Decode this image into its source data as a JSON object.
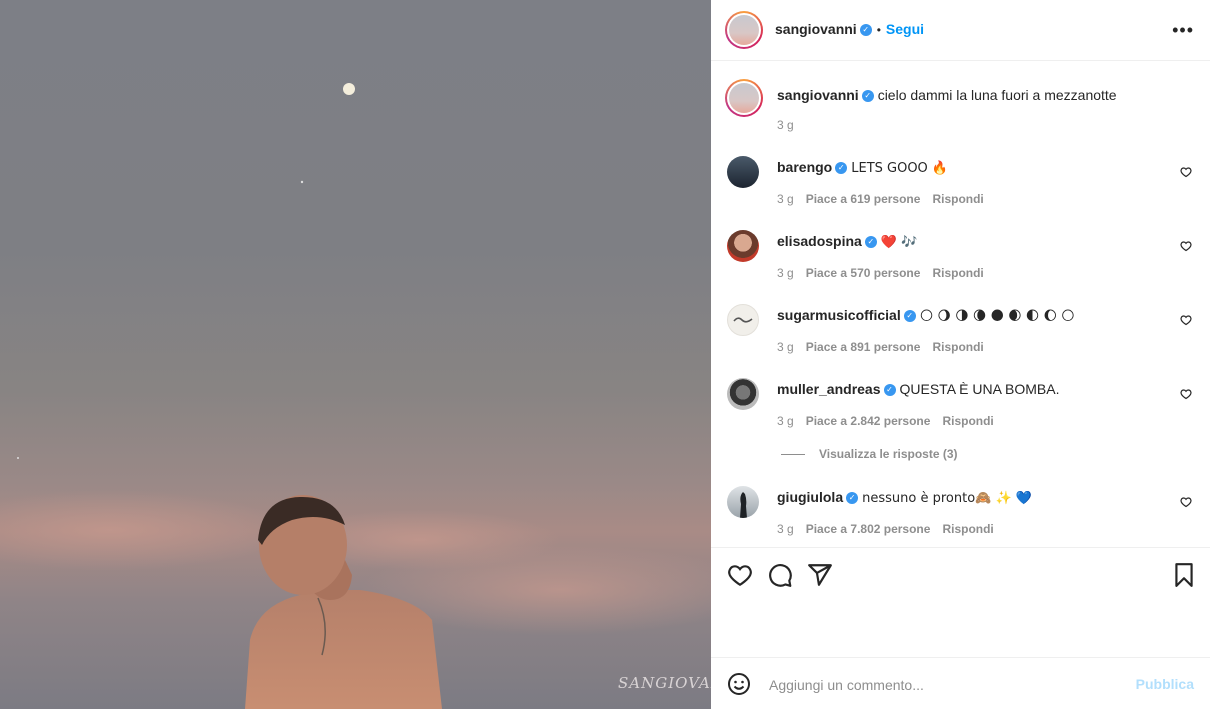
{
  "post": {
    "author": "sangiovanni",
    "follow_label": "Segui",
    "more_icon": "•••",
    "caption": "cielo dammi la luna fuori a mezzanotte",
    "caption_time": "3 g",
    "photo_signature": "SANGIOVANNI"
  },
  "comments": [
    {
      "user": "barengo",
      "text": "LETS GOOO 🔥",
      "time": "3 g",
      "likes": "Piace a 619 persone",
      "reply": "Rispondi"
    },
    {
      "user": "elisadospina",
      "text": "❤️ 🎶",
      "time": "3 g",
      "likes": "Piace a 570 persone",
      "reply": "Rispondi"
    },
    {
      "user": "sugarmusicofficial",
      "text": "🌕 🌖 🌗 🌘 🌑 🌒 🌓 🌔 🌕",
      "time": "3 g",
      "likes": "Piace a 891 persone",
      "reply": "Rispondi"
    },
    {
      "user": "muller_andreas",
      "text": "QUESTA È UNA BOMBA.",
      "time": "3 g",
      "likes": "Piace a 2.842 persone",
      "reply": "Rispondi"
    },
    {
      "user": "giugiulola",
      "text": "nessuno è pronto🙈 ✨ 💙",
      "time": "3 g",
      "likes": "Piace a 7.802 persone",
      "reply": "Rispondi"
    }
  ],
  "view_replies": "Visualizza le risposte (3)",
  "add_comment": {
    "placeholder": "Aggiungi un commento...",
    "publish": "Pubblica"
  },
  "colors": {
    "accent": "#0095f6",
    "verified": "#3897f0",
    "publish_disabled": "#b2dffc",
    "muted": "#8e8e8e"
  },
  "icons": [
    "heart-icon",
    "comment-icon",
    "share-icon",
    "bookmark-icon",
    "emoji-icon",
    "verified-icon",
    "more-icon"
  ]
}
